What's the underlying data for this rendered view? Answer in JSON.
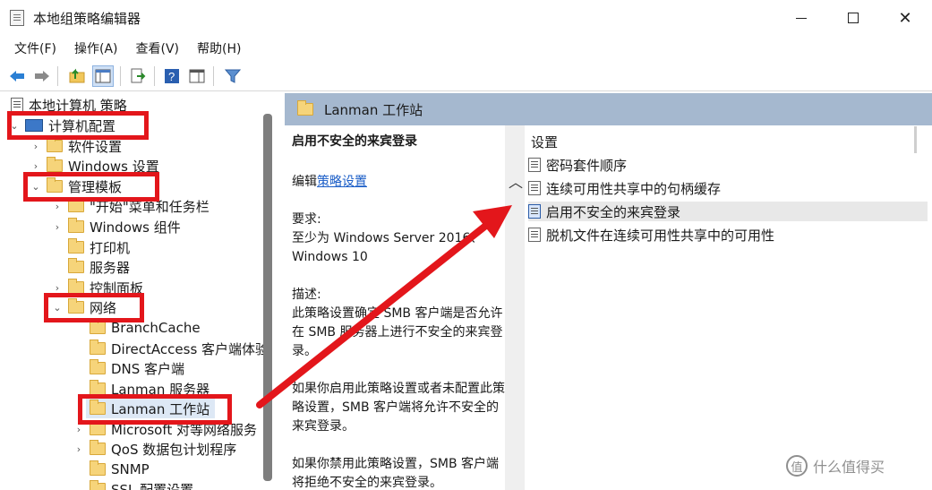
{
  "window": {
    "title": "本地组策略编辑器"
  },
  "menu": [
    "文件(F)",
    "操作(A)",
    "查看(V)",
    "帮助(H)"
  ],
  "toolbar_icons": [
    "back-arrow-icon",
    "forward-arrow-icon",
    "up-folder-icon",
    "show-tree-icon",
    "export-list-icon",
    "help-icon",
    "properties-icon",
    "filter-icon"
  ],
  "tree": {
    "root": "本地计算机 策略",
    "items": [
      {
        "label": "计算机配置",
        "expanded": true
      },
      {
        "label": "软件设置"
      },
      {
        "label": "Windows 设置"
      },
      {
        "label": "管理模板",
        "expanded": true
      },
      {
        "label": "\"开始\"菜单和任务栏"
      },
      {
        "label": "Windows 组件"
      },
      {
        "label": "打印机"
      },
      {
        "label": "服务器"
      },
      {
        "label": "控制面板"
      },
      {
        "label": "网络",
        "expanded": true
      },
      {
        "label": "BranchCache"
      },
      {
        "label": "DirectAccess 客户端体验"
      },
      {
        "label": "DNS 客户端"
      },
      {
        "label": "Lanman 服务器"
      },
      {
        "label": "Lanman 工作站",
        "selected": true
      },
      {
        "label": "Microsoft 对等网络服务"
      },
      {
        "label": "QoS 数据包计划程序"
      },
      {
        "label": "SNMP"
      },
      {
        "label": "SSL 配置设置"
      }
    ]
  },
  "right": {
    "header": "Lanman 工作站",
    "description": {
      "title": "启用不安全的来宾登录",
      "edit_prefix": "编辑",
      "edit_link": "策略设置",
      "requirement_label": "要求:",
      "requirement_text": "至少为 Windows Server 2016、Windows 10",
      "desc_label": "描述:",
      "desc_text": "此策略设置确定 SMB 客户端是否允许在 SMB 服务器上进行不安全的来宾登录。",
      "enabled_text": "如果你启用此策略设置或者未配置此策略设置，SMB 客户端将允许不安全的来宾登录。",
      "disabled_text": "如果你禁用此策略设置，SMB 客户端将拒绝不安全的来宾登录。"
    },
    "settings_header": "设置",
    "settings": [
      {
        "label": "密码套件顺序"
      },
      {
        "label": "连续可用性共享中的句柄缓存"
      },
      {
        "label": "启用不安全的来宾登录",
        "selected": true
      },
      {
        "label": "脱机文件在连续可用性共享中的可用性"
      }
    ]
  },
  "watermark": {
    "badge": "值",
    "text": "什么值得买"
  },
  "colors": {
    "highlight": "#e3161b",
    "header_bg": "#a5b8cf",
    "link": "#1a5dc7"
  }
}
